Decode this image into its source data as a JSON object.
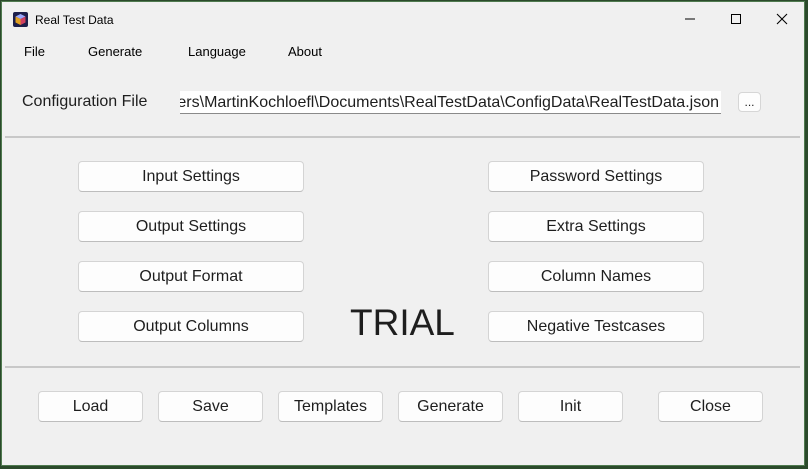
{
  "window": {
    "title": "Real Test Data"
  },
  "menu": {
    "items": [
      "File",
      "Generate",
      "Language",
      "About"
    ]
  },
  "config": {
    "label": "Configuration File",
    "value": "sers\\MartinKochloefl\\Documents\\RealTestData\\ConfigData\\RealTestData.json",
    "browse_label": "..."
  },
  "settings": {
    "left": [
      "Input Settings",
      "Output Settings",
      "Output Format",
      "Output Columns"
    ],
    "right": [
      "Password Settings",
      "Extra Settings",
      "Column Names",
      "Negative Testcases"
    ]
  },
  "watermark": "TRIAL",
  "actions": [
    "Load",
    "Save",
    "Templates",
    "Generate",
    "Init",
    "Close"
  ],
  "colors": {
    "background": "#f0f0f0",
    "desktop": "#2b4a2b",
    "separator": "#c8c8c8"
  },
  "icons": {
    "app": "app-cube-icon",
    "minimize": "minimize-icon",
    "maximize": "maximize-icon",
    "close": "close-icon"
  }
}
